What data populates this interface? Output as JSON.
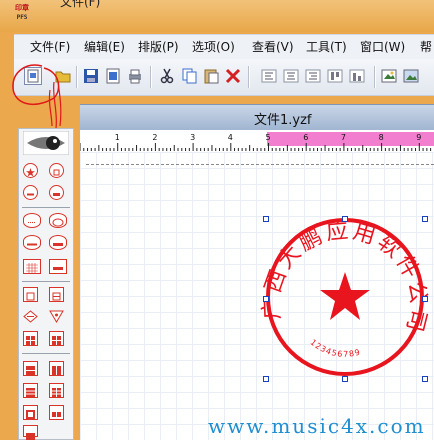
{
  "app": {
    "logo_top": "印章",
    "logo_bottom": "PFS",
    "title_fragment": "文件(F)"
  },
  "menu": {
    "items": [
      "文件(F)",
      "编辑(E)",
      "排版(P)",
      "选项(O)",
      "查看(V)",
      "工具(T)",
      "窗口(W)",
      "帮"
    ]
  },
  "toolbar": {
    "buttons": [
      "new-document-icon",
      "save-icon",
      "export-icon",
      "print-icon",
      "cut-icon",
      "copy-icon",
      "paste-icon",
      "delete-icon",
      "align-left-icon",
      "align-center-icon",
      "align-right-icon",
      "align-top-icon",
      "align-bottom-icon",
      "open-folder-icon",
      "image-icon"
    ]
  },
  "document": {
    "title": "文件1.yzf",
    "ruler_labels": [
      "1",
      "2",
      "3",
      "4",
      "5",
      "6",
      "7",
      "8",
      "9"
    ]
  },
  "seal": {
    "company_text": "广西大鹏应用软件公司",
    "serial_text": "123456789",
    "color": "#e8141e"
  },
  "palette": {
    "shapes": [
      "eye-icon",
      "star-circle-icon",
      "star-square-icon",
      "circle-line-icon",
      "circle-bar-icon",
      "oval-dotted-icon",
      "oval-double-icon",
      "oval-line-icon",
      "oval-bar-icon",
      "rect-grid-icon",
      "rect-dotted-icon",
      "square-inner-icon",
      "square-split-icon",
      "diamond-icon",
      "triangle-star-icon",
      "grid-square-icon",
      "grid-square-2-icon",
      "grid-square-3-icon",
      "grid-square-4-icon",
      "grid-square-5-icon",
      "grid-square-6-icon",
      "grid-square-7-icon",
      "grid-square-8-icon",
      "grid-square-9-icon"
    ]
  },
  "watermark": "www.music4x.com",
  "colors": {
    "frame_orange": "#eba84c",
    "seal_red": "#e8141e",
    "ruler_pink": "#f27ed0",
    "handle_blue": "#1a3fc0",
    "watermark_blue": "#1f8fd1"
  }
}
